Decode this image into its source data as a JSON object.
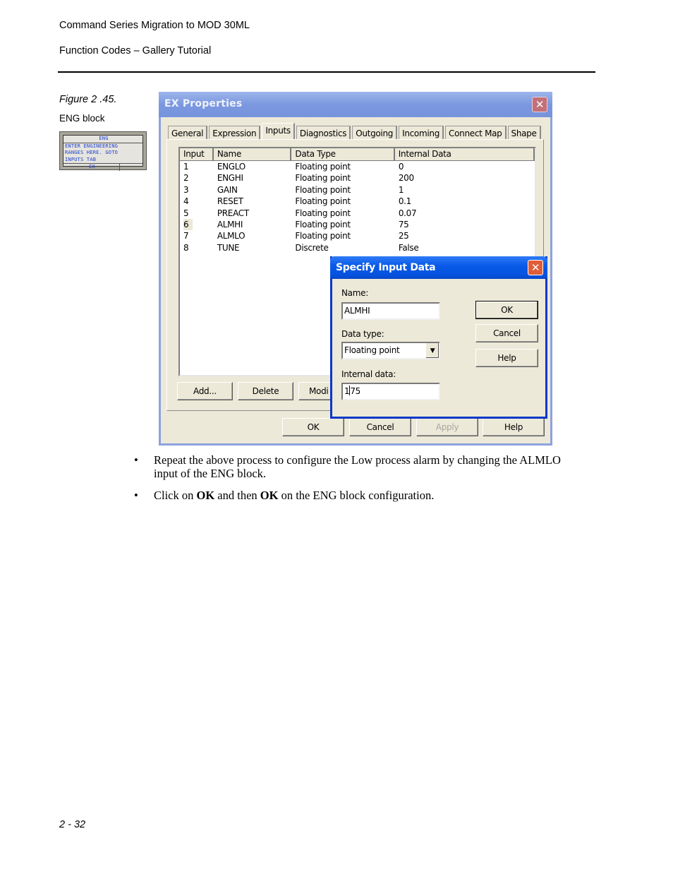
{
  "header": {
    "line1": "Command Series Migration to MOD 30ML",
    "line2": "Function Codes – Gallery Tutorial"
  },
  "figure": {
    "caption": "Figure 2 .45.",
    "subcaption": "ENG block",
    "eng_block": {
      "title": "ENG",
      "lines": [
        "ENTER ENGINEERING",
        "RANGES HERE. GOTO",
        "INPUTS TAB"
      ],
      "footer": "EX"
    }
  },
  "ex_properties": {
    "title": "EX Properties",
    "close_icon": "close-icon",
    "tabs": [
      {
        "label": "General",
        "active": false
      },
      {
        "label": "Expression",
        "active": false
      },
      {
        "label": "Inputs",
        "active": true
      },
      {
        "label": "Diagnostics",
        "active": false
      },
      {
        "label": "Outgoing",
        "active": false
      },
      {
        "label": "Incoming",
        "active": false
      },
      {
        "label": "Connect Map",
        "active": false
      },
      {
        "label": "Shape",
        "active": false
      }
    ],
    "columns": [
      "Input",
      "Name",
      "Data Type",
      "Internal Data"
    ],
    "rows": [
      {
        "input": "1",
        "name": "ENGLO",
        "type": "Floating point",
        "data": "0"
      },
      {
        "input": "2",
        "name": "ENGHI",
        "type": "Floating point",
        "data": "200"
      },
      {
        "input": "3",
        "name": "GAIN",
        "type": "Floating point",
        "data": "1"
      },
      {
        "input": "4",
        "name": "RESET",
        "type": "Floating point",
        "data": "0.1"
      },
      {
        "input": "5",
        "name": "PREACT",
        "type": "Floating point",
        "data": "0.07"
      },
      {
        "input": "6",
        "name": "ALMHI",
        "type": "Floating point",
        "data": "75"
      },
      {
        "input": "7",
        "name": "ALMLO",
        "type": "Floating point",
        "data": "25"
      },
      {
        "input": "8",
        "name": "TUNE",
        "type": "Discrete",
        "data": "False"
      }
    ],
    "selected_row": 6,
    "panel_buttons": {
      "add": "Add...",
      "delete": "Delete",
      "modify": "Modi"
    },
    "buttons": {
      "ok": "OK",
      "cancel": "Cancel",
      "apply": "Apply",
      "help": "Help"
    }
  },
  "specify_input": {
    "title": "Specify Input Data",
    "name_label": "Name:",
    "name_value": "ALMHI",
    "type_label": "Data type:",
    "type_value": "Floating point",
    "internal_label": "Internal data:",
    "internal_before_caret": "1",
    "internal_after_caret": "75",
    "buttons": {
      "ok": "OK",
      "cancel": "Cancel",
      "help": "Help"
    }
  },
  "body": {
    "bullets": [
      {
        "parts": [
          {
            "t": "Repeat the above process to configure the Low process alarm by changing the ALMLO input of the ENG block.",
            "b": false
          }
        ]
      },
      {
        "parts": [
          {
            "t": "Click on ",
            "b": false
          },
          {
            "t": "OK",
            "b": true
          },
          {
            "t": " and then ",
            "b": false
          },
          {
            "t": "OK",
            "b": true
          },
          {
            "t": " on the ENG block configuration.",
            "b": false
          }
        ]
      }
    ]
  },
  "footer": {
    "page": "2 - 32"
  }
}
